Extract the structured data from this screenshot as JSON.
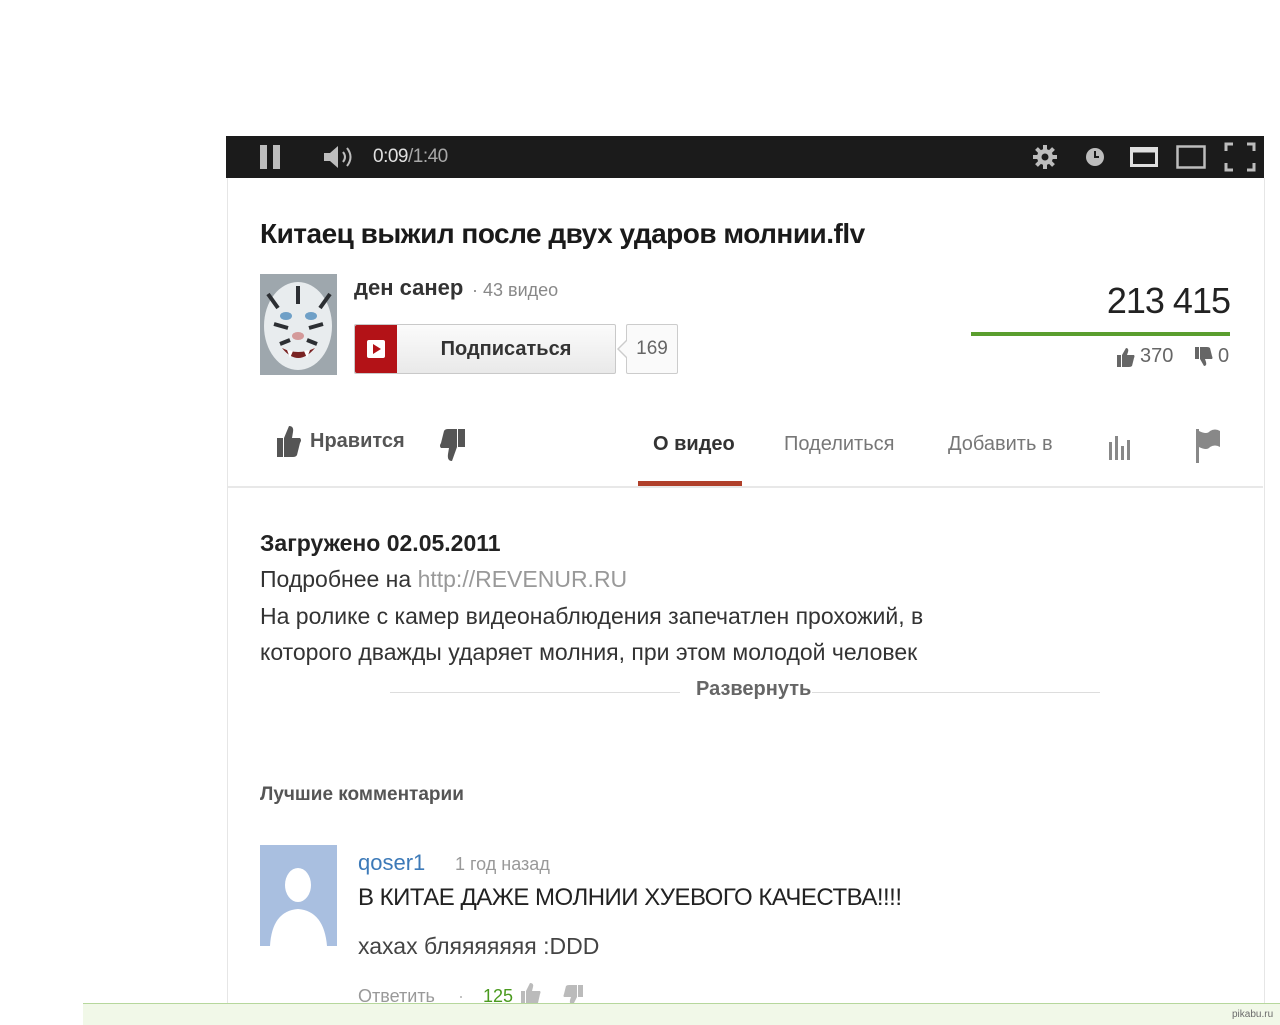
{
  "player": {
    "time_current": "0:09",
    "time_separator": " / ",
    "time_duration": "1:40"
  },
  "video": {
    "title": "Китаец выжил после двух ударов молнии.flv",
    "views": "213 415",
    "likes": "370",
    "dislikes": "0"
  },
  "channel": {
    "name": "ден санер",
    "video_count": "· 43 видео",
    "subscribe_label": "Подписаться",
    "subscriber_count": "169"
  },
  "actions": {
    "like_label": "Нравится",
    "tabs": {
      "about": "О видео",
      "share": "Поделиться",
      "add_to": "Добавить в"
    }
  },
  "description": {
    "uploaded": "Загружено 02.05.2011",
    "more_prefix": "Подробнее на ",
    "more_link": "http://REVENUR.RU",
    "line1": "На ролике с камер видеонаблюдения запечатлен прохожий, в",
    "line2": "которого дважды ударяет молния, при этом молодой человек",
    "expand_label": "Развернуть"
  },
  "comments": {
    "heading": "Лучшие комментарии",
    "items": [
      {
        "author": "qoser1",
        "time": "1 год назад",
        "line1": "В КИТАЕ ДАЖЕ МОЛНИИ ХУЕВОГО КАЧЕСТВА!!!!",
        "line2": "хахах бляяяяяяя :DDD",
        "reply_label": "Ответить",
        "separator": "·",
        "likes": "125"
      }
    ]
  },
  "watermark": "pikabu.ru",
  "colors": {
    "player_bg": "#1b1b1b",
    "subscribe_red": "#b31217",
    "like_bar_green": "#5a9e2e",
    "tab_underline": "#b0402a",
    "comment_author_blue": "#3d7ab8",
    "comment_likes_green": "#4a9a1e"
  }
}
